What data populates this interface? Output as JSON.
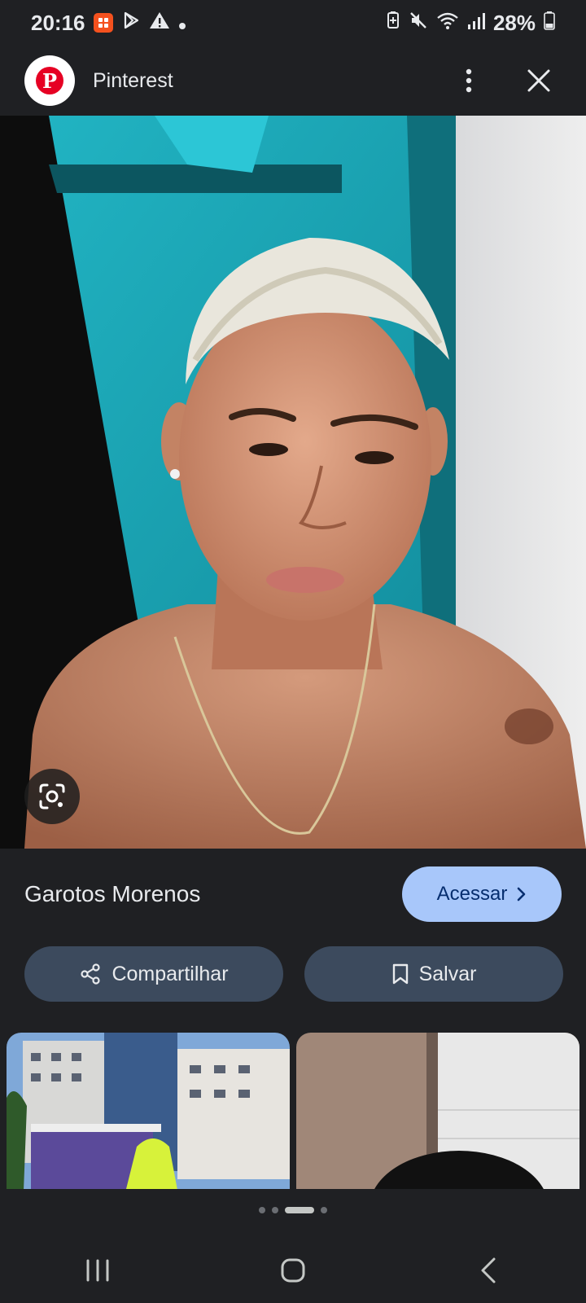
{
  "status": {
    "time": "20:16",
    "battery": "28%",
    "icons": [
      "notification-app-icon",
      "play-store-icon",
      "warning-icon",
      "dot-icon",
      "battery-saver-icon",
      "mute-icon",
      "wifi-icon",
      "signal-icon",
      "battery-icon"
    ]
  },
  "header": {
    "title": "Pinterest",
    "logo_letter": "P"
  },
  "result": {
    "caption": "Garotos Morenos",
    "visit_label": "Acessar"
  },
  "actions": {
    "share_label": "Compartilhar",
    "save_label": "Salvar"
  },
  "pagination": {
    "count": 4,
    "active_index": 2
  },
  "colors": {
    "background": "#1f2023",
    "visit_button": "#a8c7fa",
    "action_button": "#3c4a5d",
    "pinterest_red": "#e60023"
  }
}
